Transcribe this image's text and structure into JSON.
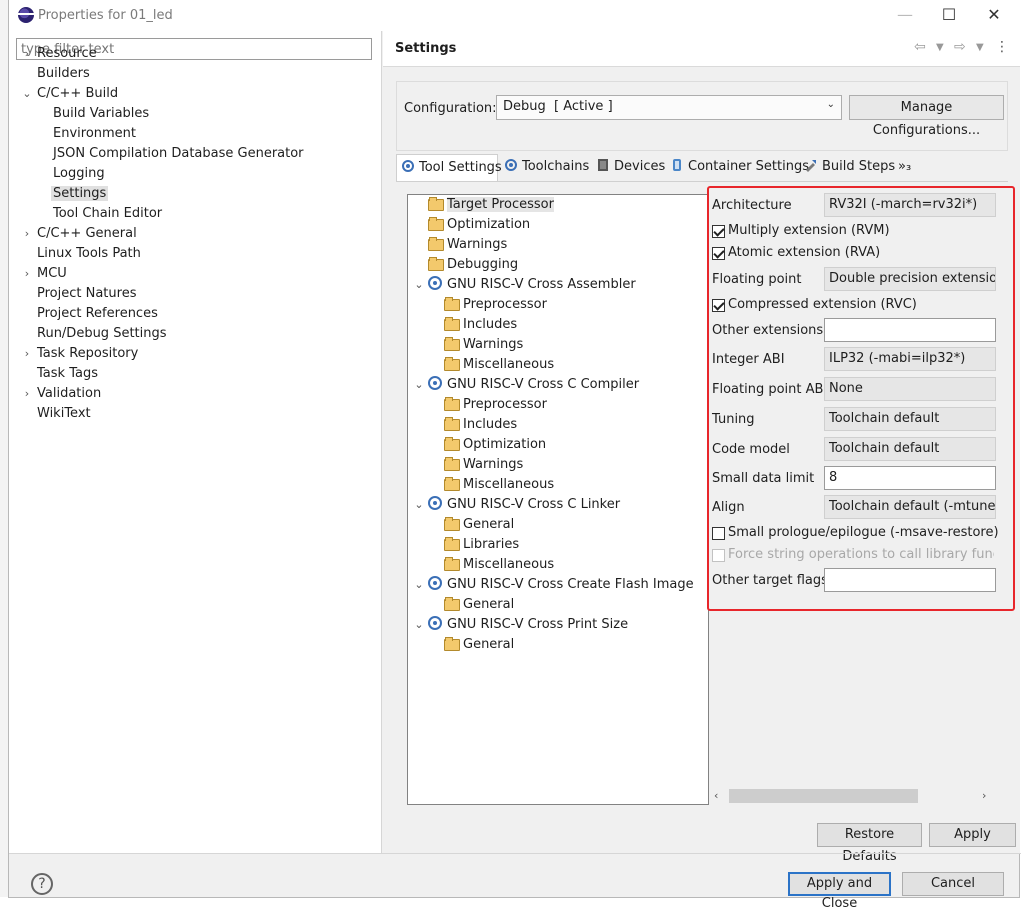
{
  "window": {
    "title": "Properties for 01_led",
    "minimize": "—",
    "maximize": "☐",
    "close": "✕"
  },
  "filter": {
    "placeholder": "type filter text"
  },
  "nav": [
    {
      "label": "Resource",
      "expander": "collapsed",
      "level": 0
    },
    {
      "label": "Builders",
      "expander": "none",
      "level": 0
    },
    {
      "label": "C/C++ Build",
      "expander": "expanded",
      "level": 0
    },
    {
      "label": "Build Variables",
      "expander": "none",
      "level": 1
    },
    {
      "label": "Environment",
      "expander": "none",
      "level": 1
    },
    {
      "label": "JSON Compilation Database Generator",
      "expander": "none",
      "level": 1
    },
    {
      "label": "Logging",
      "expander": "none",
      "level": 1
    },
    {
      "label": "Settings",
      "expander": "none",
      "level": 1,
      "selected": true
    },
    {
      "label": "Tool Chain Editor",
      "expander": "none",
      "level": 1
    },
    {
      "label": "C/C++ General",
      "expander": "collapsed",
      "level": 0
    },
    {
      "label": "Linux Tools Path",
      "expander": "none",
      "level": 0
    },
    {
      "label": "MCU",
      "expander": "collapsed",
      "level": 0
    },
    {
      "label": "Project Natures",
      "expander": "none",
      "level": 0
    },
    {
      "label": "Project References",
      "expander": "none",
      "level": 0
    },
    {
      "label": "Run/Debug Settings",
      "expander": "none",
      "level": 0
    },
    {
      "label": "Task Repository",
      "expander": "collapsed",
      "level": 0
    },
    {
      "label": "Task Tags",
      "expander": "none",
      "level": 0
    },
    {
      "label": "Validation",
      "expander": "collapsed",
      "level": 0
    },
    {
      "label": "WikiText",
      "expander": "none",
      "level": 0
    }
  ],
  "settings": {
    "title": "Settings",
    "configuration_label": "Configuration:",
    "configuration_value": "Debug  [ Active ]",
    "manage_button": "Manage Configurations..."
  },
  "tabs": [
    {
      "label": "Tool Settings",
      "icon": "tool-settings-icon",
      "active": true
    },
    {
      "label": "Toolchains",
      "icon": "toolchains-icon"
    },
    {
      "label": "Devices",
      "icon": "devices-icon"
    },
    {
      "label": "Container Settings",
      "icon": "container-icon"
    },
    {
      "label": "Build Steps",
      "icon": "build-steps-icon"
    },
    {
      "label": "»₃",
      "icon": "overflow-icon"
    }
  ],
  "tool_tree": [
    {
      "label": "Target Processor",
      "level": 0,
      "type": "folder",
      "selected": true
    },
    {
      "label": "Optimization",
      "level": 0,
      "type": "folder"
    },
    {
      "label": "Warnings",
      "level": 0,
      "type": "folder"
    },
    {
      "label": "Debugging",
      "level": 0,
      "type": "folder"
    },
    {
      "label": "GNU RISC-V Cross Assembler",
      "level": 0,
      "type": "tool"
    },
    {
      "label": "Preprocessor",
      "level": 1,
      "type": "folder"
    },
    {
      "label": "Includes",
      "level": 1,
      "type": "folder"
    },
    {
      "label": "Warnings",
      "level": 1,
      "type": "folder"
    },
    {
      "label": "Miscellaneous",
      "level": 1,
      "type": "folder"
    },
    {
      "label": "GNU RISC-V Cross C Compiler",
      "level": 0,
      "type": "tool"
    },
    {
      "label": "Preprocessor",
      "level": 1,
      "type": "folder"
    },
    {
      "label": "Includes",
      "level": 1,
      "type": "folder"
    },
    {
      "label": "Optimization",
      "level": 1,
      "type": "folder"
    },
    {
      "label": "Warnings",
      "level": 1,
      "type": "folder"
    },
    {
      "label": "Miscellaneous",
      "level": 1,
      "type": "folder"
    },
    {
      "label": "GNU RISC-V Cross C Linker",
      "level": 0,
      "type": "tool"
    },
    {
      "label": "General",
      "level": 1,
      "type": "folder"
    },
    {
      "label": "Libraries",
      "level": 1,
      "type": "folder"
    },
    {
      "label": "Miscellaneous",
      "level": 1,
      "type": "folder"
    },
    {
      "label": "GNU RISC-V Cross Create Flash Image",
      "level": 0,
      "type": "tool"
    },
    {
      "label": "General",
      "level": 1,
      "type": "folder"
    },
    {
      "label": "GNU RISC-V Cross Print Size",
      "level": 0,
      "type": "tool"
    },
    {
      "label": "General",
      "level": 1,
      "type": "folder"
    }
  ],
  "options": {
    "architecture_label": "Architecture",
    "architecture_value": "RV32I (-march=rv32i*)",
    "multiply_label": "Multiply extension (RVM)",
    "multiply_checked": true,
    "atomic_label": "Atomic extension (RVA)",
    "atomic_checked": true,
    "floating_label": "Floating point",
    "floating_value": "Double precision extension (",
    "compressed_label": "Compressed extension (RVC)",
    "compressed_checked": true,
    "other_ext_label": "Other extensions",
    "other_ext_value": "",
    "integer_abi_label": "Integer ABI",
    "integer_abi_value": "ILP32 (-mabi=ilp32*)",
    "fp_abi_label": "Floating point ABI",
    "fp_abi_value": "None",
    "tuning_label": "Tuning",
    "tuning_value": "Toolchain default",
    "code_model_label": "Code model",
    "code_model_value": "Toolchain default",
    "small_data_label": "Small data limit",
    "small_data_value": "8",
    "align_label": "Align",
    "align_value": "Toolchain default (-mtune)",
    "prologue_label": "Small prologue/epilogue (-msave-restore)",
    "prologue_checked": false,
    "force_string_label": "Force string operations to call library function",
    "force_string_checked": false,
    "other_flags_label": "Other target flags",
    "other_flags_value": ""
  },
  "buttons": {
    "restore_defaults": "Restore Defaults",
    "apply": "Apply",
    "apply_close": "Apply and Close",
    "cancel": "Cancel",
    "help": "?"
  },
  "colors": {
    "highlight_border": "#e8262b",
    "primary_button": "#2b73c7"
  }
}
